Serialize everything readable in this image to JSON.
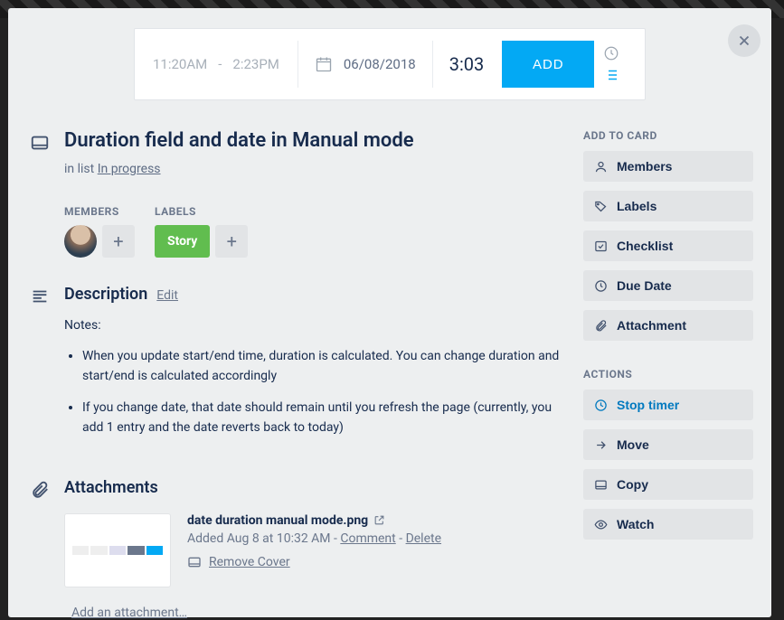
{
  "timer": {
    "start_time": "11:20AM",
    "end_time": "2:23PM",
    "separator": "-",
    "date": "06/08/2018",
    "duration": "3:03",
    "add_label": "ADD"
  },
  "card": {
    "title": "Duration field and date in Manual mode",
    "list_prefix": "in list ",
    "list_name": "In progress"
  },
  "meta": {
    "members_label": "MEMBERS",
    "labels_label": "LABELS",
    "story_label": "Story"
  },
  "description": {
    "heading": "Description",
    "edit_label": "Edit",
    "notes_label": "Notes:",
    "bullets": [
      "When you update start/end time, duration is calculated. You can change duration and start/end is calculated accordingly",
      "If you change date, that date should remain until you refresh the page (currently, you add 1 entry and the date reverts back to today)"
    ]
  },
  "attachments": {
    "heading": "Attachments",
    "items": [
      {
        "name": "date duration manual mode.png",
        "meta_prefix": "Added Aug 8 at 10:32 AM - ",
        "comment_label": "Comment",
        "delete_label": "Delete",
        "remove_cover_label": "Remove Cover"
      }
    ],
    "add_label": "Add an attachment…"
  },
  "sidebar": {
    "add_heading": "ADD TO CARD",
    "add_items": [
      {
        "icon": "user",
        "label": "Members"
      },
      {
        "icon": "tag",
        "label": "Labels"
      },
      {
        "icon": "check",
        "label": "Checklist"
      },
      {
        "icon": "clock",
        "label": "Due Date"
      },
      {
        "icon": "paperclip",
        "label": "Attachment"
      }
    ],
    "actions_heading": "ACTIONS",
    "action_items": [
      {
        "icon": "stoptimer",
        "label": "Stop timer",
        "primary": true
      },
      {
        "icon": "arrow",
        "label": "Move"
      },
      {
        "icon": "card",
        "label": "Copy"
      },
      {
        "icon": "eye",
        "label": "Watch"
      }
    ]
  }
}
